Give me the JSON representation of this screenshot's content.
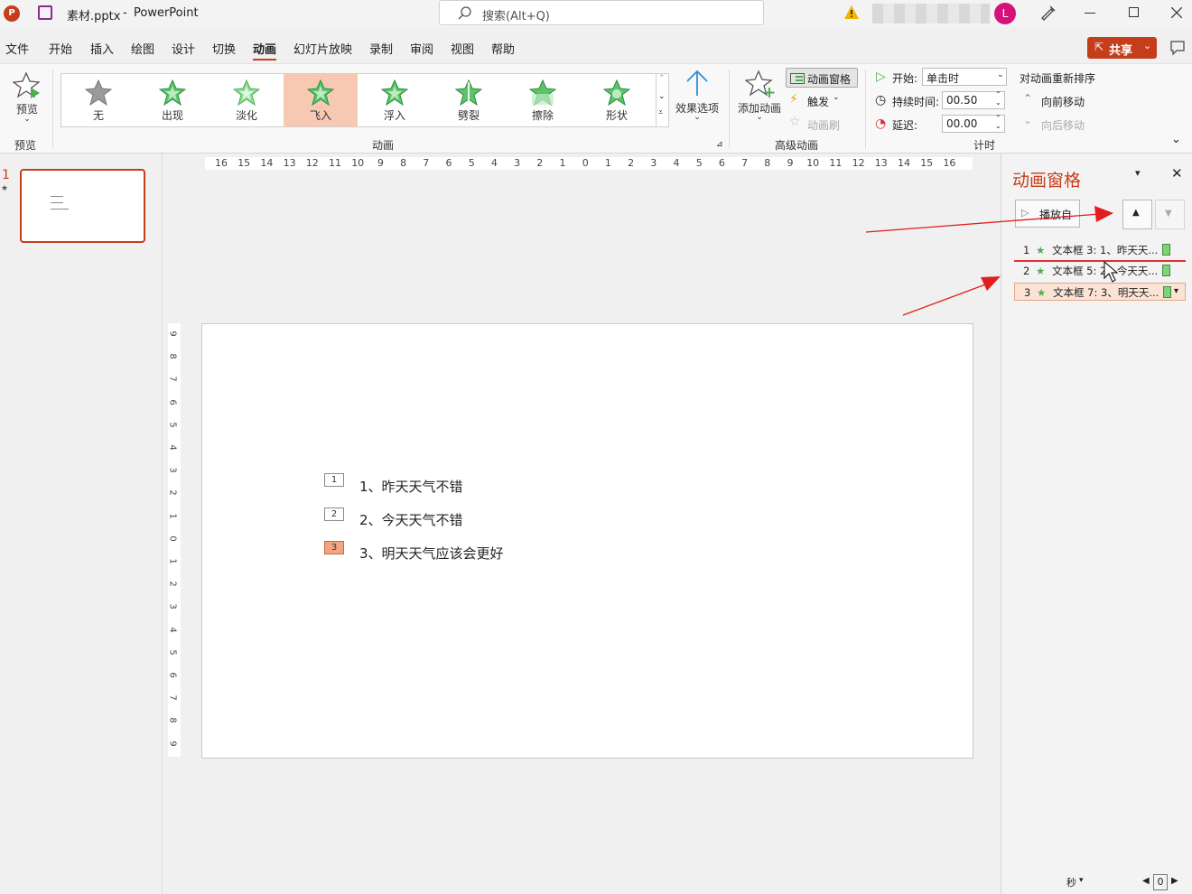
{
  "titlebar": {
    "filename": "素材.pptx",
    "separator": "-",
    "app": "PowerPoint",
    "search_placeholder": "搜索(Alt+Q)",
    "avatar_letter": "L"
  },
  "menu": {
    "items": [
      "文件",
      "开始",
      "插入",
      "绘图",
      "设计",
      "切换",
      "动画",
      "幻灯片放映",
      "录制",
      "审阅",
      "视图",
      "帮助"
    ],
    "active": "动画",
    "share_label": "共享"
  },
  "ribbon": {
    "preview_label": "预览",
    "preview_group": "预览",
    "gallery": [
      {
        "label": "无",
        "selected": false
      },
      {
        "label": "出现",
        "selected": false
      },
      {
        "label": "淡化",
        "selected": false
      },
      {
        "label": "飞入",
        "selected": true
      },
      {
        "label": "浮入",
        "selected": false
      },
      {
        "label": "劈裂",
        "selected": false
      },
      {
        "label": "擦除",
        "selected": false
      },
      {
        "label": "形状",
        "selected": false
      }
    ],
    "effect_options_label": "效果选项",
    "animation_group": "动画",
    "add_animation_label": "添加动画",
    "anim_pane_label": "动画窗格",
    "trigger_label": "触发",
    "anim_painter_label": "动画刷",
    "advanced_group": "高级动画",
    "start_label": "开始:",
    "start_value": "单击时",
    "duration_label": "持续时间:",
    "duration_value": "00.50",
    "delay_label": "延迟:",
    "delay_value": "00.00",
    "timing_group": "计时",
    "reorder_title": "对动画重新排序",
    "move_earlier": "向前移动",
    "move_later": "向后移动"
  },
  "thumbnails": {
    "slide_number": "1",
    "star": "★"
  },
  "ruler": {
    "h_ticks": [
      "16",
      "15",
      "14",
      "13",
      "12",
      "11",
      "10",
      "9",
      "8",
      "7",
      "6",
      "5",
      "4",
      "3",
      "2",
      "1",
      "0",
      "1",
      "2",
      "3",
      "4",
      "5",
      "6",
      "7",
      "8",
      "9",
      "10",
      "11",
      "12",
      "13",
      "14",
      "15",
      "16"
    ],
    "v_ticks": [
      "9",
      "8",
      "7",
      "6",
      "5",
      "4",
      "3",
      "2",
      "1",
      "0",
      "1",
      "2",
      "3",
      "4",
      "5",
      "6",
      "7",
      "8",
      "9"
    ]
  },
  "slide": {
    "items": [
      {
        "tag": "1",
        "text": "1、昨天天气不错",
        "selected": false
      },
      {
        "tag": "2",
        "text": "2、今天天气不错",
        "selected": false
      },
      {
        "tag": "3",
        "text": "3、明天天气应该会更好",
        "selected": true
      }
    ]
  },
  "anim_pane": {
    "title": "动画窗格",
    "play_label": "播放自",
    "rows": [
      {
        "num": "1",
        "text": "文本框 3: 1、昨天天..."
      },
      {
        "num": "2",
        "text": "文本框 5: 2、今天天..."
      },
      {
        "num": "3",
        "text": "文本框 7: 3、明天天..."
      }
    ],
    "seconds_label": "秒",
    "zoom_value": "0"
  },
  "colors": {
    "accent": "#c43e1c",
    "selected_fill": "#f7c8b2",
    "star_green": "#4caf50",
    "arrow_red": "#e21d1d"
  }
}
